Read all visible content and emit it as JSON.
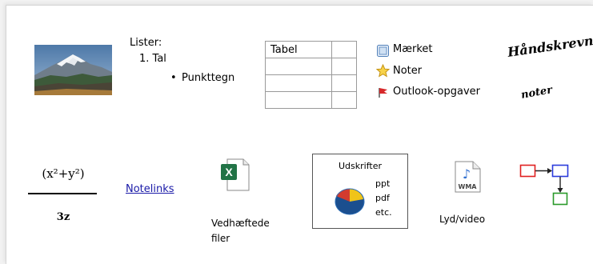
{
  "lists": {
    "heading": "Lister:",
    "numbered_item": "1. Tal",
    "bullet_item": "Punkttegn",
    "bullet_glyph": "•"
  },
  "table": {
    "rows": [
      [
        "Tabel",
        ""
      ],
      [
        "",
        ""
      ],
      [
        "",
        ""
      ],
      [
        "",
        ""
      ]
    ]
  },
  "tags": [
    {
      "label": "Mærket",
      "icon": "checkbox-icon"
    },
    {
      "label": "Noter",
      "icon": "star-icon"
    },
    {
      "label": "Outlook-opgaver",
      "icon": "flag-icon"
    }
  ],
  "handwritten": {
    "line1": "Håndskrevne",
    "line2": "noter"
  },
  "formula": {
    "numerator": "(x²+y²)",
    "denominator": "3z"
  },
  "notelink": {
    "label": "Notelinks"
  },
  "attachment": {
    "line1": "Vedhæftede",
    "line2": "filer",
    "icon": "excel-file-icon"
  },
  "printouts": {
    "title": "Udskrifter",
    "items": [
      "ppt",
      "pdf",
      "etc."
    ],
    "icon": "pie-chart-icon"
  },
  "audio": {
    "label": "Lyd/video",
    "icon_text": "WMA",
    "icon": "audio-file-icon"
  },
  "colors": {
    "link": "#1a1aa8",
    "flag": "#d6282a",
    "diagram_red": "#e02020",
    "diagram_blue": "#2b3bdc",
    "diagram_green": "#2a9a2a"
  }
}
